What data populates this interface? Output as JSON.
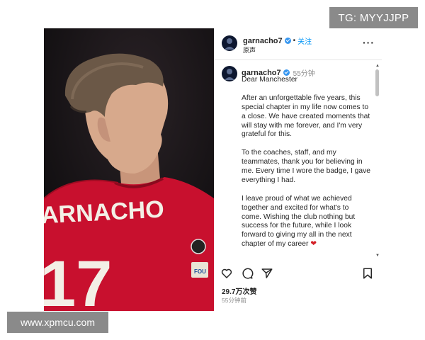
{
  "watermarks": {
    "top_right": "TG: MYYJJPP",
    "bottom_left": "www.xpmcu.com"
  },
  "photo": {
    "shirt_name": "ARNACHO",
    "shirt_number": "17",
    "sleeve_patch": "FOU",
    "colors": {
      "shirt": "#c8102e",
      "background": "#151214",
      "hair": "#6b5847",
      "skin": "#d7a98c"
    }
  },
  "post": {
    "header": {
      "username": "garnacho7",
      "separator": "•",
      "follow_label": "关注",
      "subtitle": "原声",
      "more_icon": "more-horizontal-icon"
    },
    "caption": {
      "username": "garnacho7",
      "time": "55分钟",
      "paragraphs": [
        "Dear Manchester",
        "After an unforgettable five years, this special chapter in my life now comes to a close. We have created moments that will stay with me forever, and I'm very grateful for this.",
        "To the coaches, staff, and my teammates, thank you for believing in me. Every time I wore the badge, I gave everything I had.",
        "I leave proud of what we achieved together and excited for what's to come. Wishing the club nothing but success for the future, while I look forward to giving my all in the next chapter of my career"
      ],
      "heart": "❤"
    },
    "actions": {
      "like_icon": "heart-icon",
      "comment_icon": "comment-icon",
      "share_icon": "send-icon",
      "save_icon": "bookmark-icon"
    },
    "likes": "29.7万次赞",
    "posted_ago": "55分钟前"
  },
  "colors": {
    "link": "#0095f6",
    "verified": "#3897f0",
    "text": "#262626",
    "muted": "#8e8e8e"
  }
}
